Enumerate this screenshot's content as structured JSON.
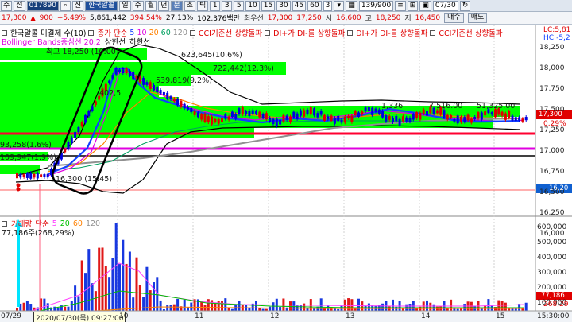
{
  "toolbar": {
    "mode1": "주",
    "mode2": "전",
    "code": "017890",
    "indicator": "신",
    "name": "한국알콜",
    "periods": [
      "일",
      "주",
      "월",
      "년",
      "분",
      "초",
      "틱"
    ],
    "active_period": "분",
    "intervals": [
      "1",
      "3",
      "5",
      "10",
      "15",
      "30",
      "45",
      "60"
    ],
    "interval_select": "3",
    "count": "139/900",
    "date": "07/30"
  },
  "quote": {
    "price": "17,300",
    "change": "900",
    "change_pct": "+5.49%",
    "volume": "5,861,442",
    "volume_ratio": "394.54%",
    "turnover": "27.13%",
    "amount": "102,376백만",
    "best_ask_label": "최우선",
    "best_ask": "17,300",
    "best_bid": "17,250",
    "open_label": "시",
    "open": "16,600",
    "high_label": "고",
    "high": "18,250",
    "low_label": "저",
    "low": "16,450",
    "buy_btn": "매수",
    "sell_btn": "매도"
  },
  "legend_top": {
    "stock_label": "한국알콜",
    "sub_label": "미결제",
    "count_label": "수(10)",
    "price_label": "종가",
    "ma_prefix": "단순",
    "ma_periods": [
      "5",
      "10",
      "20",
      "60",
      "120"
    ],
    "signals": [
      "CCI기준선 상향돌파",
      "DI+가 DI-를 상향돌파",
      "DI+가 DI-를 상향돌파",
      "CCI기준선 상향돌파"
    ]
  },
  "legend_second": {
    "bollinger": "Bollinger Bands중심선 20,2",
    "upper": "상한선",
    "lower": "하한선"
  },
  "volume_legend": {
    "label": "거래량",
    "ma_prefix": "단순",
    "ma_periods": [
      "5",
      "20",
      "60",
      "120"
    ],
    "current": "77,186주(268,29%)"
  },
  "annotations": {
    "high": "최고 18,250 (10:00)",
    "low": "16,300 (15:45)",
    "v1": "623,645(10.6%)",
    "v2": "722,442(12.3%)",
    "v3": "539,819(9.2%)",
    "v4": "402,5",
    "v5": "1,336",
    "v6": "7,516.00",
    "v7": "51,325.00",
    "v8": "93,258(1.6%)",
    "v9": "109,947(1.9%)"
  },
  "right_axis": {
    "top_tags": [
      "LC:5,81",
      "HC:-5,2"
    ],
    "price_ticks": [
      "18,250",
      "18,000",
      "17,750",
      "17,500",
      "17,250",
      "17,000",
      "16,750",
      "16,500",
      "16,250",
      "16,000"
    ],
    "last_price": "17,300",
    "last_pct": "0.29%",
    "low_tag": "16,20",
    "vol_ticks": [
      "600,000",
      "500,000",
      "400,000",
      "300,000",
      "200,000",
      "100,000"
    ],
    "vol_last": "77,186",
    "vol_last_pct": "268,29"
  },
  "x_axis": {
    "start_date": "07/29",
    "cursor_date": "2020/07/30(목) 09:27:00",
    "hours": [
      "10",
      "11",
      "12",
      "13",
      "14",
      "15"
    ],
    "end_time": "15:30:00"
  },
  "colors": {
    "up": "#e00000",
    "down": "#0000e0",
    "green_band": "#00ff00",
    "magenta_line": "#e000e0",
    "red_line": "#ff0000",
    "cyan_arrow": "#00e5ff"
  }
}
